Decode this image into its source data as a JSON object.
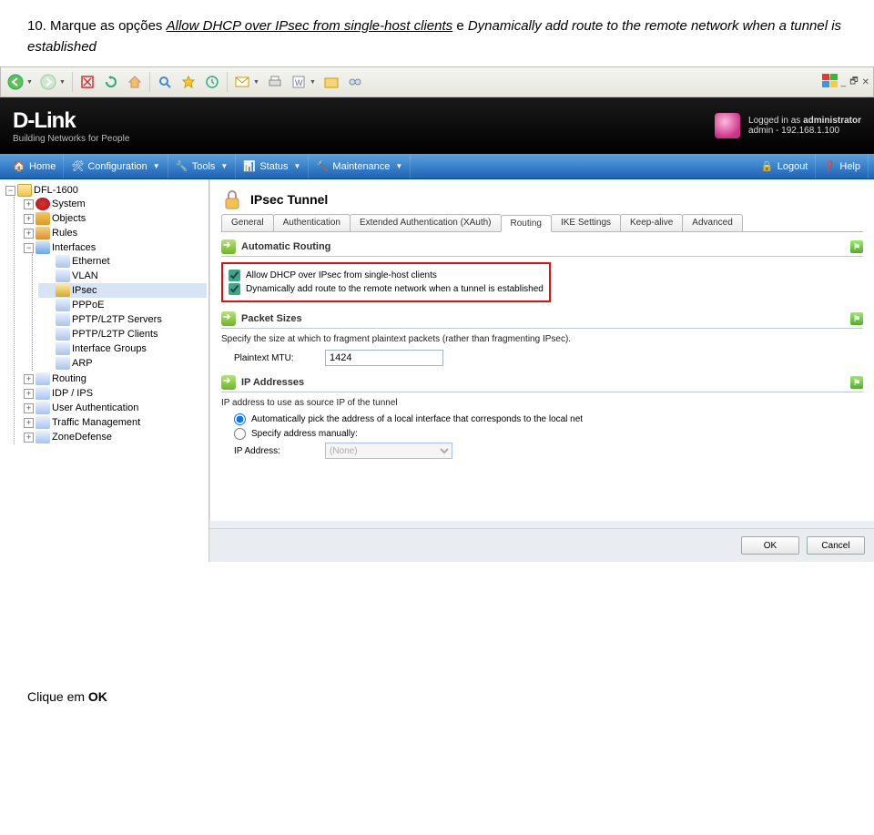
{
  "instruction": {
    "number": "10.",
    "lead": "Marque as opções",
    "opt1": "Allow DHCP over IPsec from single-host clients",
    "join": "e",
    "opt2": "Dynamically add route to the remote network when a tunnel is established"
  },
  "login": {
    "line1_a": "Logged in as ",
    "line1_b": "administrator",
    "line2": "admin - 192.168.1.100"
  },
  "logo": {
    "brand": "D-Link",
    "tag": "Building Networks for People"
  },
  "nav": {
    "home": "Home",
    "config": "Configuration",
    "tools": "Tools",
    "status": "Status",
    "maint": "Maintenance",
    "logout": "Logout",
    "help": "Help"
  },
  "tree": {
    "root": "DFL-1600",
    "system": "System",
    "objects": "Objects",
    "rules": "Rules",
    "interfaces": "Interfaces",
    "ethernet": "Ethernet",
    "vlan": "VLAN",
    "ipsec": "IPsec",
    "pppoe": "PPPoE",
    "pptp_srv": "PPTP/L2TP Servers",
    "pptp_cli": "PPTP/L2TP Clients",
    "ifgroups": "Interface Groups",
    "arp": "ARP",
    "routing": "Routing",
    "idp": "IDP / IPS",
    "userauth": "User Authentication",
    "traffic": "Traffic Management",
    "zone": "ZoneDefense"
  },
  "page": {
    "title": "IPsec Tunnel",
    "tabs": [
      "General",
      "Authentication",
      "Extended Authentication (XAuth)",
      "Routing",
      "IKE Settings",
      "Keep-alive",
      "Advanced"
    ],
    "active_tab_index": 3
  },
  "auto_routing": {
    "head": "Automatic Routing",
    "chk1": "Allow DHCP over IPsec from single-host clients",
    "chk2": "Dynamically add route to the remote network when a tunnel is established"
  },
  "packet": {
    "head": "Packet Sizes",
    "desc": "Specify the size at which to fragment plaintext packets (rather than fragmenting IPsec).",
    "mtu_label": "Plaintext MTU:",
    "mtu_value": "1424"
  },
  "ipaddr": {
    "head": "IP Addresses",
    "desc": "IP address to use as source IP of the tunnel",
    "radio_auto": "Automatically pick the address of a local interface that corresponds to the local net",
    "radio_manual": "Specify address manually:",
    "ip_label": "IP Address:",
    "ip_value": "(None)"
  },
  "buttons": {
    "ok": "OK",
    "cancel": "Cancel"
  },
  "footer": {
    "prefix": "Clique em ",
    "bold": "OK"
  }
}
